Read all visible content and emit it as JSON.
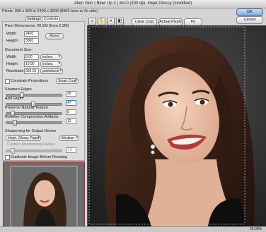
{
  "window": {
    "title": "Alien Skin | Blow Up 2 | 8x10 (300 dpi, Inkjet Glossy (modified)"
  },
  "info": {
    "pixels": "Pixels: 900 x 893 to 2400 x 3000 (8969 area or 3x side)"
  },
  "buttons": {
    "ok": "OK",
    "cancel": "Cancel",
    "settings_tab": "Settings",
    "controls_tab": "Controls",
    "reset": "Reset",
    "clear_crop": "Clear Crop",
    "actual_pixels": "Actual Pixels",
    "fit_screen": "Fit Screen"
  },
  "pixel_dims": {
    "header": "Pixel Dimensions: 20.5M (from 2.2M)",
    "width_label": "Width",
    "width_value": "2400",
    "height_label": "Height",
    "height_value": "3000"
  },
  "doc_size": {
    "header": "Document Size:",
    "width_label": "Width",
    "width_value": "8.00",
    "width_unit": "inches",
    "height_label": "Height",
    "height_value": "10.00",
    "height_unit": "inches",
    "res_label": "Resolution",
    "res_value": "300.00",
    "res_unit": "pixels/inch"
  },
  "constrain": {
    "label": "Constrain Proportions",
    "mode": "Smart Crop"
  },
  "sliders": {
    "sharpen": {
      "label": "Sharpen Edges",
      "value": "26",
      "level": 0.26
    },
    "grain": {
      "label": "Add Grain",
      "value": "47",
      "level": 0.47
    },
    "texture": {
      "label": "Preserve Natural Texture",
      "value": "8",
      "level": 0.08
    },
    "compression": {
      "label": "Remove Compression Artifacts",
      "value": "12",
      "level": 0.12
    }
  },
  "sharpening": {
    "header": "Sharpening for Output Device",
    "device": "Inkjet, Glossy Paper",
    "amount": "Medium",
    "custom_label": "Custom Sharpening Radius",
    "custom_value": "1.0"
  },
  "duplicate": {
    "label": "Duplicate Image Before Resizing"
  },
  "status": {
    "zoom": "25.00%"
  },
  "icons": {
    "tool1": "zoom-icon",
    "tool2": "hand-icon",
    "tool3": "crop-icon",
    "tool4": "compare-icon"
  }
}
